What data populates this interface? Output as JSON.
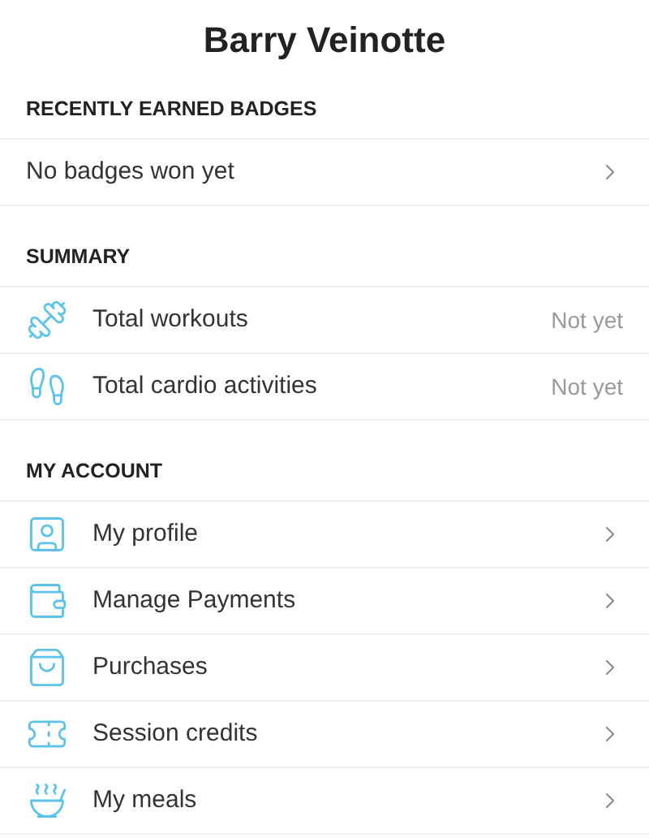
{
  "title": "Barry Veinotte",
  "sections": [
    {
      "heading": "RECENTLY EARNED BADGES",
      "rows": [
        {
          "label": "No badges won yet",
          "kind": "link"
        }
      ]
    },
    {
      "heading": "SUMMARY",
      "rows": [
        {
          "label": "Total workouts",
          "kind": "stat",
          "value": "Not yet"
        },
        {
          "label": "Total cardio activities",
          "kind": "stat",
          "value": "Not yet"
        }
      ]
    },
    {
      "heading": "MY ACCOUNT",
      "rows": [
        {
          "label": "My profile",
          "kind": "link"
        },
        {
          "label": "Manage Payments",
          "kind": "link"
        },
        {
          "label": "Purchases",
          "kind": "link"
        },
        {
          "label": "Session credits",
          "kind": "link"
        },
        {
          "label": "My meals",
          "kind": "link"
        }
      ]
    }
  ]
}
